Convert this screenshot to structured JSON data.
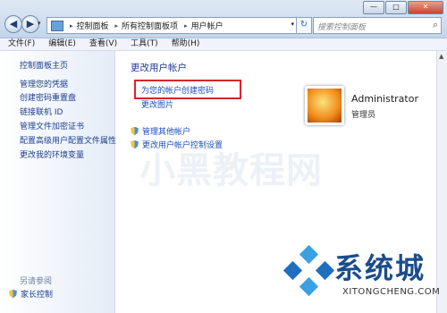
{
  "window": {
    "min_label": "—",
    "max_label": "□",
    "close_label": "✕"
  },
  "nav": {
    "back": "◀",
    "forward": "▶",
    "dropdown": "▾",
    "refresh": "↻"
  },
  "address": {
    "crumbs": [
      "控制面板",
      "所有控制面板项",
      "用户帐户"
    ],
    "sep": "▸",
    "dropdown": "▾"
  },
  "search": {
    "placeholder": "搜索控制面板",
    "icon": "⌕"
  },
  "menubar": {
    "items": [
      "文件(F)",
      "编辑(E)",
      "查看(V)",
      "工具(T)",
      "帮助(H)"
    ]
  },
  "sidebar": {
    "home": "控制面板主页",
    "links": [
      "管理您的凭据",
      "创建密码重置盘",
      "链接联机 ID",
      "管理文件加密证书",
      "配置高级用户配置文件属性",
      "更改我的环境变量"
    ],
    "also": "另请参阅",
    "parental": "家长控制"
  },
  "main": {
    "title": "更改用户帐户",
    "create_password": "为您的帐户创建密码",
    "change_picture": "更改图片",
    "manage_other": "管理其他帐户",
    "change_uac": "更改用户帐户控制设置"
  },
  "account": {
    "name": "Administrator",
    "role": "管理员"
  },
  "watermark": "小黑教程网",
  "logo": {
    "text": "系统城",
    "sub": "XITONGCHENG.COM"
  },
  "colors": {
    "link": "#1b4eb8",
    "highlight": "#d9232a",
    "heading": "#1f3a8c"
  }
}
